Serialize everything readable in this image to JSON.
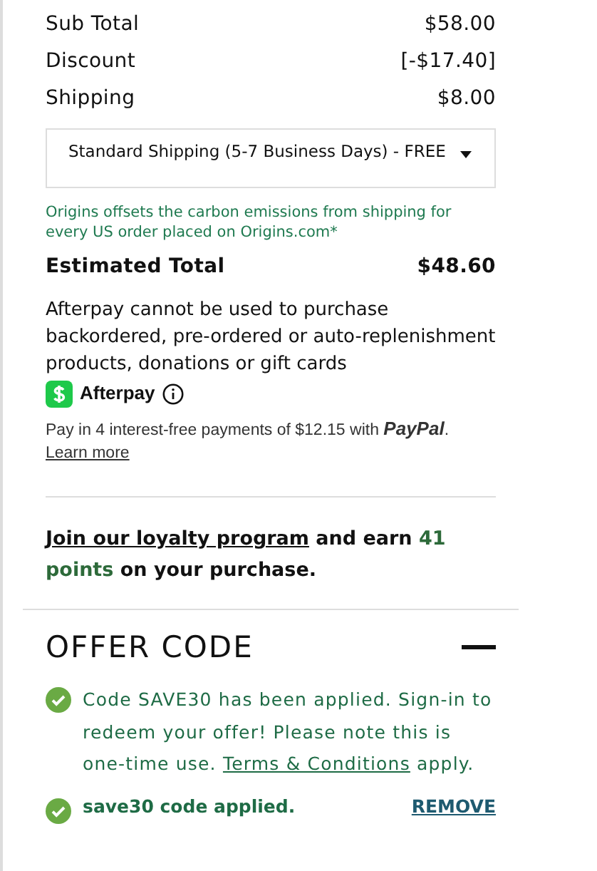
{
  "summary": [
    {
      "label": "Sub Total",
      "value": "$58.00"
    },
    {
      "label": "Discount",
      "value": "[-$17.40]"
    },
    {
      "label": "Shipping",
      "value": "$8.00"
    }
  ],
  "shipping_select": {
    "value": "Standard Shipping (5-7 Business Days) - FREE"
  },
  "carbon_note": "Origins offsets the carbon emissions from shipping for every US order placed on Origins.com*",
  "estimated_total": {
    "label": "Estimated Total",
    "value": "$48.60"
  },
  "afterpay": {
    "note": "Afterpay cannot be used to purchase backordered, pre-ordered or auto-replenishment products, donations or gift cards",
    "brand": "Afterpay"
  },
  "paypal": {
    "text": "Pay in 4 interest-free payments of $12.15 with",
    "brand": "PayPal",
    "after": ".",
    "link": "Learn more"
  },
  "loyalty": {
    "link": "Join our loyalty program",
    "text": "and earn",
    "points": "41 points",
    "text_end": "on your purchase."
  },
  "offer_code": {
    "title": "OFFER CODE",
    "expanded": true,
    "message": {
      "text": "Code SAVE30 has been applied. Sign-in to redeem your offer! Please note this is one-time use.",
      "link": "Terms & Conditions",
      "text_end": "apply."
    },
    "applied": {
      "text": "save30 code applied.",
      "action": "REMOVE"
    }
  }
}
